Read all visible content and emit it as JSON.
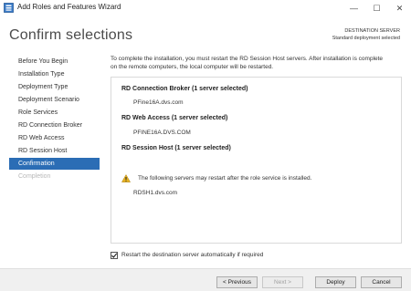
{
  "window": {
    "title": "Add Roles and Features Wizard",
    "minimize": "—",
    "maximize": "☐",
    "close": "✕"
  },
  "header": {
    "title": "Confirm selections",
    "destination_label": "DESTINATION SERVER",
    "destination_value": "Standard deployment selected"
  },
  "nav": {
    "items": [
      {
        "label": "Before You Begin",
        "state": "normal"
      },
      {
        "label": "Installation Type",
        "state": "normal"
      },
      {
        "label": "Deployment Type",
        "state": "normal"
      },
      {
        "label": "Deployment Scenario",
        "state": "normal"
      },
      {
        "label": "Role Services",
        "state": "normal"
      },
      {
        "label": "RD Connection Broker",
        "state": "normal"
      },
      {
        "label": "RD Web Access",
        "state": "normal"
      },
      {
        "label": "RD Session Host",
        "state": "normal"
      },
      {
        "label": "Confirmation",
        "state": "active"
      },
      {
        "label": "Completion",
        "state": "disabled"
      }
    ]
  },
  "main": {
    "intro_line1": "To complete the installation, you must restart the RD Session Host servers. After installation is complete",
    "intro_line2": "on the remote computers, the local computer will be restarted.",
    "roles": [
      {
        "heading": "RD Connection Broker  (1 server selected)",
        "server": "PFine16A.dvs.com"
      },
      {
        "heading": "RD Web Access  (1 server selected)",
        "server": "PFINE16A.DVS.COM"
      },
      {
        "heading": "RD Session Host  (1 server selected)",
        "server": "RDSH1.dvs.com"
      }
    ],
    "warning": "The following servers may restart after the role service is installed.",
    "restart_checkbox": {
      "label": "Restart the destination server automatically if required",
      "checked": true
    }
  },
  "footer": {
    "previous": "< Previous",
    "next": "Next >",
    "deploy": "Deploy",
    "cancel": "Cancel"
  },
  "colors": {
    "nav_active": "#2b6db5",
    "warning": "#e8b321"
  }
}
